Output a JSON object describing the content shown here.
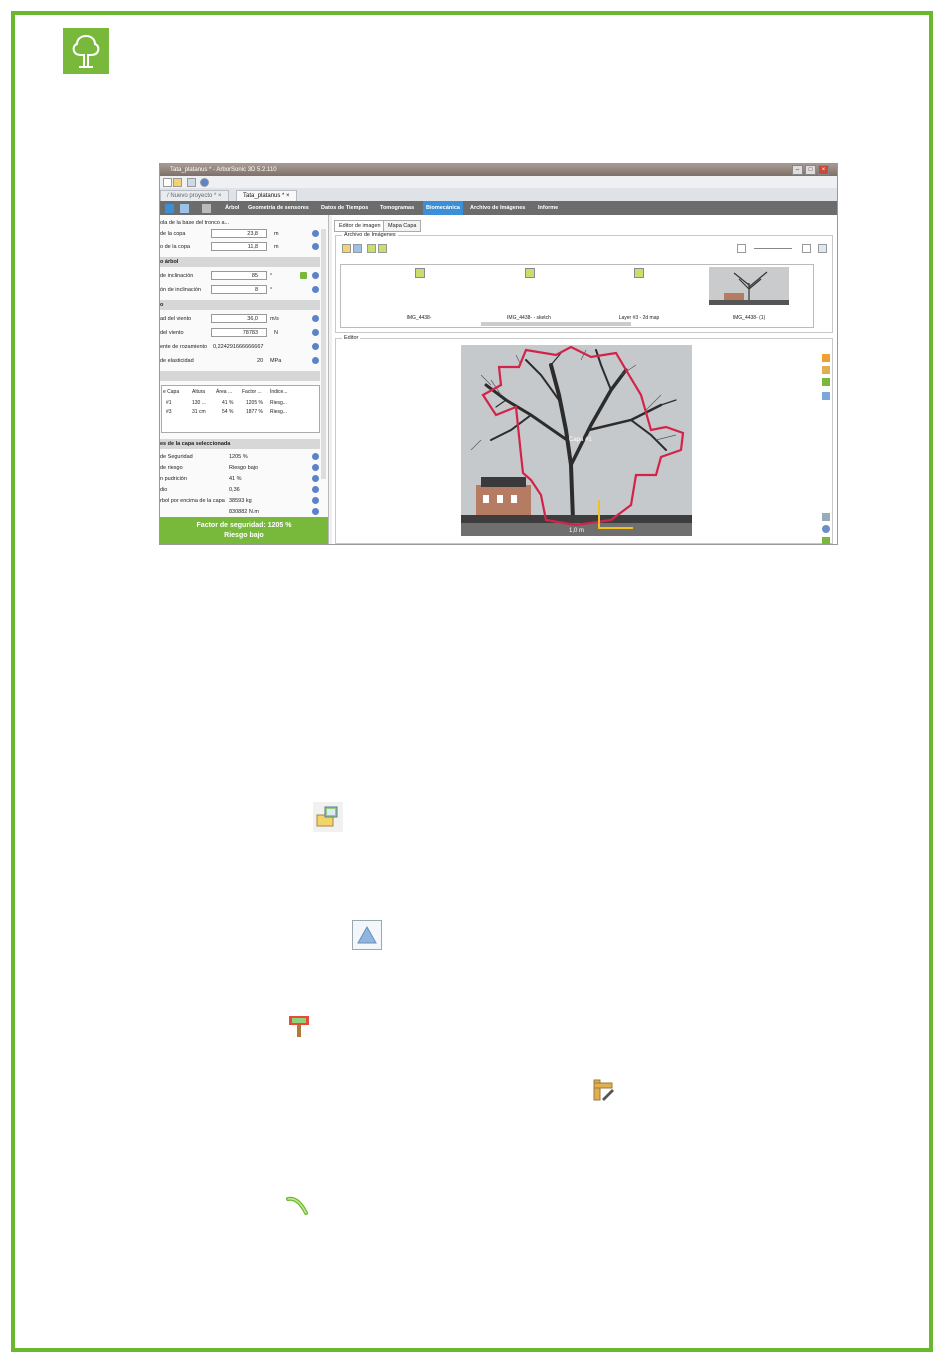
{
  "window": {
    "title": "Tata_platanus * - ArborSonic 3D 5.2.110",
    "buttons": [
      "–",
      "□",
      "×"
    ]
  },
  "project_tabs": [
    {
      "label": "/ Nuevo proyecto *  ×"
    },
    {
      "label": "Tata_platanus *  ×"
    }
  ],
  "menu": [
    {
      "label": "Árbol"
    },
    {
      "label": "Geometría de sensores"
    },
    {
      "label": "Datos de Tiempos"
    },
    {
      "label": "Tomogramas"
    },
    {
      "label": "Biomecánica"
    },
    {
      "label": "Archivo de Imágenes"
    },
    {
      "label": "Informe"
    }
  ],
  "left": {
    "top_label": "ola de la base del tronco a...",
    "rows1": [
      {
        "label": "de la copa",
        "value": "23,8",
        "unit": "m"
      },
      {
        "label": "o de la copa",
        "value": "11,8",
        "unit": "m"
      }
    ],
    "sec_tree": "o árbol",
    "rows2": [
      {
        "label": "de inclinación",
        "value": "85",
        "unit": "°"
      },
      {
        "label": "ón de inclinación",
        "value": "8",
        "unit": "°"
      }
    ],
    "sec_wind": "o",
    "rows3": [
      {
        "label": "ad del viento",
        "value": "36,0",
        "unit": "m/s"
      },
      {
        "label": "del viento",
        "value": "78783",
        "unit": "N"
      }
    ],
    "friction_label": "ente de rozamiento",
    "friction_value": "0,224291666666667",
    "elasticity_label": "de elasticidad",
    "elasticity_value": "20",
    "elasticity_unit": "MPa",
    "table": {
      "headers": [
        "e Capa",
        "Altura",
        "Área ...",
        "Factor ...",
        "Índice..."
      ],
      "rows": [
        [
          "#1",
          "130 ...",
          "41 %",
          "1205 %",
          "Riesg..."
        ],
        [
          "#3",
          "31 cm",
          "54 %",
          "1877 %",
          "Riesg..."
        ]
      ]
    },
    "sec_layer": "es de la capa seleccionada",
    "props": [
      {
        "label": "de Seguridad",
        "value": "1205 %"
      },
      {
        "label": "de riesgo",
        "value": "Riesgo bajo"
      },
      {
        "label": "n pudrición",
        "value": "41 %"
      },
      {
        "label": "dio",
        "value": "0,36"
      },
      {
        "label": "rbol por encima de la capa",
        "value": "38593 kg"
      },
      {
        "label": "",
        "value": "830882 N.m"
      }
    ],
    "safety_line1": "Factor de seguridad: 1205 %",
    "safety_line2": "Riesgo bajo"
  },
  "right": {
    "tabs": [
      {
        "label": "Editor de imagen"
      },
      {
        "label": "Mapa Capa"
      }
    ],
    "archive_label": "Archivo de Imágenes",
    "editor_label": "Editor",
    "thumbnails": [
      {
        "label": "IMG_4438-"
      },
      {
        "label": "IMG_4438- - sketch"
      },
      {
        "label": "Layer #3 - 2d map"
      },
      {
        "label": "IMG_4438- (1)"
      }
    ],
    "overlay_label": "Capa #1",
    "scale_label": "1,0 m"
  },
  "doc_icons": [
    {
      "name": "load-image-icon"
    },
    {
      "name": "triangle-mode-icon"
    },
    {
      "name": "tree-marker-icon"
    },
    {
      "name": "measure-edit-icon"
    },
    {
      "name": "curve-tool-icon"
    }
  ],
  "colors": {
    "frame": "#6ab82e",
    "accent_green": "#78b83a",
    "menu_selected": "#3c8fd6",
    "outline": "#d2234a"
  }
}
